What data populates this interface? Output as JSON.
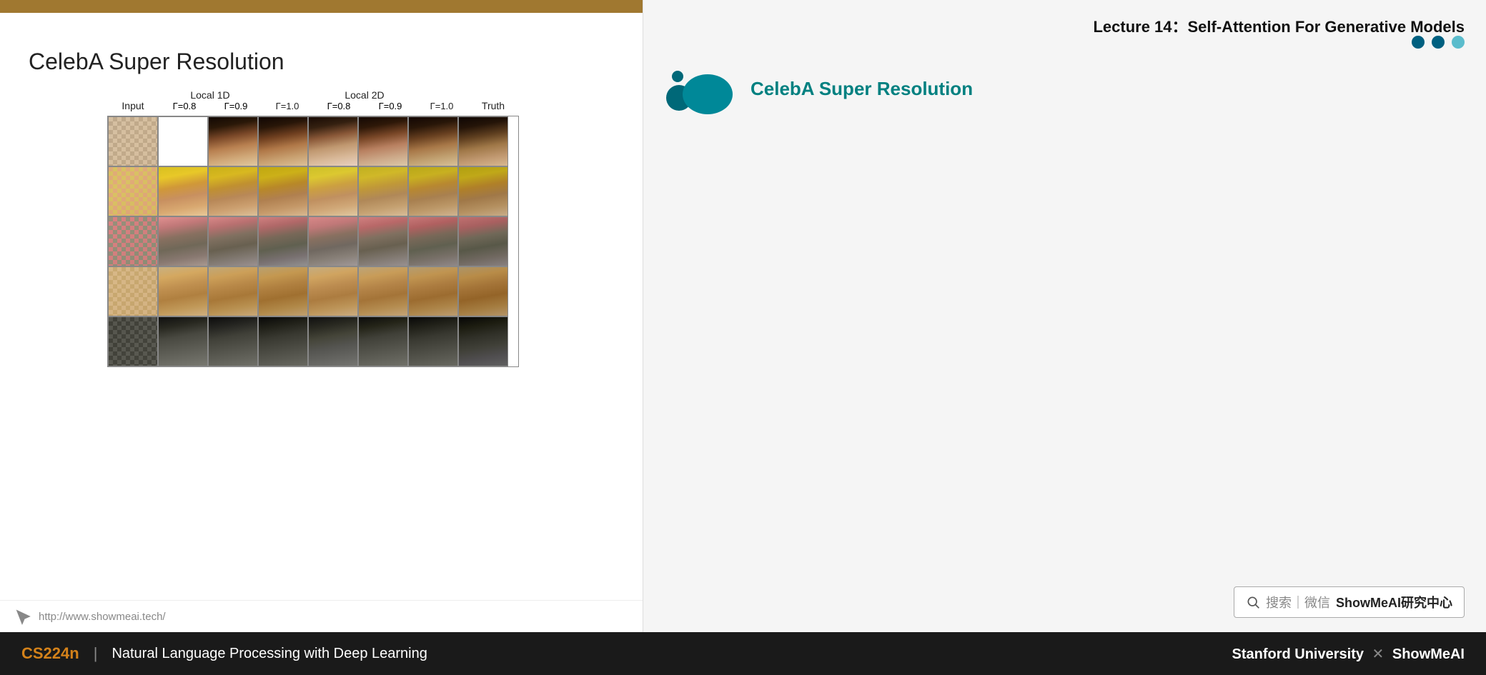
{
  "slide": {
    "top_bar_color": "#a07830",
    "title": "CelebA Super Resolution",
    "column_headers": [
      {
        "main": "Input",
        "sub": ""
      },
      {
        "main": "Local 1D",
        "sub": "Γ=0.8"
      },
      {
        "main": "",
        "sub": "Γ=0.9"
      },
      {
        "main": "",
        "sub": "Γ=1.0"
      },
      {
        "main": "Local 2D",
        "sub": "Γ=0.8"
      },
      {
        "main": "",
        "sub": "Γ=0.9"
      },
      {
        "main": "",
        "sub": "Γ=1.0"
      },
      {
        "main": "Truth",
        "sub": ""
      }
    ],
    "footer_url": "http://www.showmeai.tech/"
  },
  "right_panel": {
    "lecture_title": "Lecture 14：Self-Attention For Generative Models",
    "slide_title": "CelebA Super Resolution",
    "nav_dots": [
      "filled",
      "filled",
      "light"
    ]
  },
  "search_bar": {
    "icon": "search-icon",
    "text": "搜索｜微信 ShowMeAI研究中心"
  },
  "bottom_bar": {
    "course_code": "CS224n",
    "pipe": "|",
    "course_name": "Natural Language Processing with Deep Learning",
    "right_text": "Stanford University",
    "x_separator": "✕",
    "brand": "ShowMeAI"
  }
}
